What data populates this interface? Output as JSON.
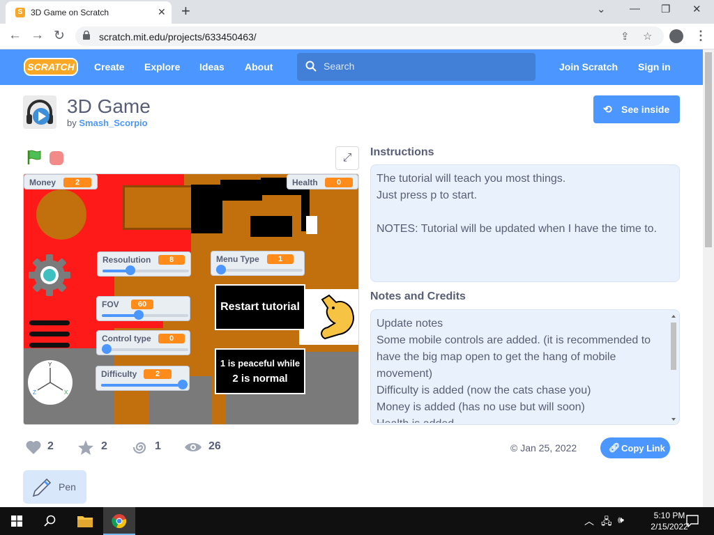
{
  "browser": {
    "tab_title": "3D Game on Scratch",
    "url": "scratch.mit.edu/projects/633450463/"
  },
  "header": {
    "logo": "SCRATCH",
    "nav": [
      "Create",
      "Explore",
      "Ideas",
      "About"
    ],
    "search_placeholder": "Search",
    "join": "Join Scratch",
    "signin": "Sign in"
  },
  "project": {
    "title": "3D Game",
    "by": "by",
    "author": "Smash_Scorpio",
    "see_inside": "See inside"
  },
  "stage": {
    "monitors": {
      "money": {
        "label": "Money",
        "value": "2"
      },
      "health": {
        "label": "Health",
        "value": "0"
      },
      "resolution": {
        "label": "Resoulution",
        "value": "8",
        "level": 0.3
      },
      "menu_type": {
        "label": "Menu Type",
        "value": "1",
        "level": 0.0
      },
      "fov": {
        "label": "FOV",
        "value": "60",
        "level": 0.42
      },
      "control_type": {
        "label": "Control type",
        "value": "0",
        "level": 0.0
      },
      "difficulty": {
        "label": "Difficulty",
        "value": "2",
        "level": 1.0
      }
    },
    "restart_text": "Restart tutorial",
    "difficulty_line1": "1 is peaceful while",
    "difficulty_line2": "2 is normal"
  },
  "instructions": {
    "title": "Instructions",
    "lines": [
      "The tutorial will teach you most things.",
      "Just press p to start.",
      "",
      "NOTES: Tutorial will be updated when I have the time to."
    ]
  },
  "notes": {
    "title": "Notes and Credits",
    "lines": [
      "Update notes",
      "Some mobile controls are added. (it is recommended to",
      "have the big map open to get the hang of mobile",
      "movement)",
      "Difficulty is added (now the cats chase you)",
      "Money is added (has no use but will soon)",
      "Health is added"
    ]
  },
  "stats": {
    "loves": "2",
    "favorites": "2",
    "remixes": "1",
    "views": "26",
    "date": "© Jan 25, 2022",
    "copy_link": "Copy Link"
  },
  "tags": {
    "pen": "Pen"
  },
  "taskbar": {
    "time": "5:10 PM",
    "date": "2/15/2022"
  },
  "colors": {
    "scratch_blue": "#4c97ff",
    "stage_orange": "#c26f0e",
    "stage_red": "#ff1a1a",
    "monitor_orange": "#ff8c1a"
  }
}
